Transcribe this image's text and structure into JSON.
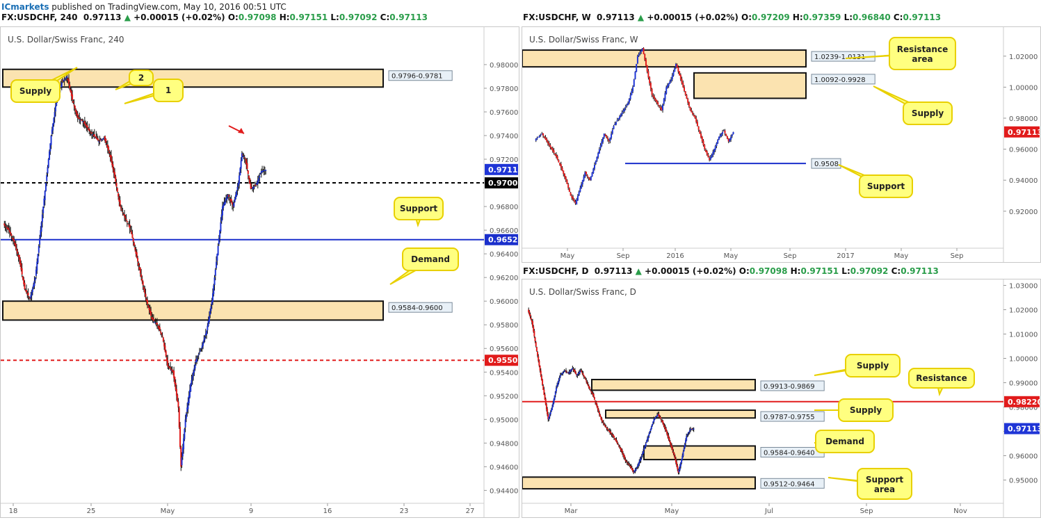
{
  "topbar": {
    "brand": "ICmarkets",
    "text": " published on TradingView.com, May 10, 2016 00:51 UTC"
  },
  "panels": [
    {
      "header": {
        "symbol": "FX:USDCHF, 240",
        "last": "0.97113",
        "change": "+0.00015 (+0.02%)",
        "o": "0.97098",
        "h": "0.97151",
        "l": "0.97092",
        "c": "0.97113"
      },
      "title": "U.S. Dollar/Swiss Franc, 240"
    },
    {
      "header": {
        "symbol": "FX:USDCHF, W",
        "last": "0.97113",
        "change": "+0.00015 (+0.02%)",
        "o": "0.97209",
        "h": "0.97359",
        "l": "0.96840",
        "c": "0.97113"
      },
      "title": "U.S. Dollar/Swiss Franc, W"
    },
    {
      "header": {
        "symbol": "FX:USDCHF, D",
        "last": "0.97113",
        "change": "+0.00015 (+0.02%)",
        "o": "0.97098",
        "h": "0.97151",
        "l": "0.97092",
        "c": "0.97113"
      },
      "title": "U.S. Dollar/Swiss Franc, D"
    }
  ],
  "chart_data": [
    {
      "type": "candlestick",
      "title": "U.S. Dollar/Swiss Franc, 240",
      "ylim": [
        0.9432,
        0.9817
      ],
      "y_ticks": [
        "0.98000",
        "0.97800",
        "0.97600",
        "0.97400",
        "0.97200",
        "0.97000",
        "0.96800",
        "0.96600",
        "0.96400",
        "0.96200",
        "0.96000",
        "0.95800",
        "0.95600",
        "0.95400",
        "0.95200",
        "0.95000",
        "0.94800",
        "0.94600",
        "0.94400"
      ],
      "x_ticks": [
        "18",
        "25",
        "May",
        "9",
        "16",
        "23",
        "27"
      ],
      "last_price_label": "0.97113",
      "zones": [
        {
          "label": "0.9796-0.9781",
          "high": 0.9796,
          "low": 0.9781
        },
        {
          "label": "0.9584-0.9600",
          "high": 0.96,
          "low": 0.9584
        }
      ],
      "levels": [
        {
          "label": "0.97000",
          "value": 0.97,
          "style": "dashed",
          "color": "#000000"
        },
        {
          "label": "0.96520",
          "value": 0.9652,
          "style": "solid",
          "color": "#1a2fcc"
        },
        {
          "label": "0.95500",
          "value": 0.955,
          "style": "dashed",
          "color": "#e11b1b"
        }
      ],
      "annotations": [
        "Supply",
        "2",
        "1",
        "Support",
        "Demand"
      ],
      "close_path": [
        [
          0,
          0.9665
        ],
        [
          6,
          0.966
        ],
        [
          12,
          0.965
        ],
        [
          18,
          0.9635
        ],
        [
          24,
          0.961
        ],
        [
          30,
          0.9602
        ],
        [
          36,
          0.962
        ],
        [
          42,
          0.966
        ],
        [
          48,
          0.97
        ],
        [
          54,
          0.974
        ],
        [
          60,
          0.977
        ],
        [
          66,
          0.9785
        ],
        [
          72,
          0.979
        ],
        [
          78,
          0.977
        ],
        [
          84,
          0.9755
        ],
        [
          90,
          0.9752
        ],
        [
          96,
          0.9745
        ],
        [
          102,
          0.974
        ],
        [
          108,
          0.9735
        ],
        [
          114,
          0.9738
        ],
        [
          120,
          0.9725
        ],
        [
          126,
          0.9705
        ],
        [
          132,
          0.968
        ],
        [
          138,
          0.967
        ],
        [
          144,
          0.966
        ],
        [
          150,
          0.964
        ],
        [
          156,
          0.962
        ],
        [
          162,
          0.96
        ],
        [
          168,
          0.9585
        ],
        [
          174,
          0.958
        ],
        [
          180,
          0.957
        ],
        [
          186,
          0.9545
        ],
        [
          192,
          0.954
        ],
        [
          198,
          0.951
        ],
        [
          201,
          0.946
        ],
        [
          206,
          0.95
        ],
        [
          212,
          0.953
        ],
        [
          218,
          0.955
        ],
        [
          224,
          0.956
        ],
        [
          230,
          0.9575
        ],
        [
          236,
          0.96
        ],
        [
          242,
          0.964
        ],
        [
          248,
          0.968
        ],
        [
          254,
          0.969
        ],
        [
          260,
          0.968
        ],
        [
          266,
          0.97
        ],
        [
          270,
          0.9725
        ],
        [
          274,
          0.972
        ],
        [
          280,
          0.9695
        ],
        [
          286,
          0.9698
        ],
        [
          292,
          0.971
        ],
        [
          297,
          0.9711
        ]
      ]
    },
    {
      "type": "candlestick",
      "title": "U.S. Dollar/Swiss Franc, W",
      "ylim": [
        0.8975,
        1.032
      ],
      "y_ticks": [
        "1.02000",
        "1.00000",
        "0.98000",
        "0.96000",
        "0.94000",
        "0.92000"
      ],
      "x_ticks": [
        "May",
        "Sep",
        "2016",
        "May",
        "Sep",
        "2017",
        "May",
        "Sep"
      ],
      "last_price_label": "0.97113",
      "zones": [
        {
          "label": "1.0239-1.0131",
          "high": 1.0239,
          "low": 1.0131
        },
        {
          "label": "1.0092-0.9928",
          "high": 1.0092,
          "low": 0.9928
        }
      ],
      "levels": [
        {
          "label": "0.9508",
          "value": 0.9508,
          "style": "solid",
          "color": "#1a2fcc"
        }
      ],
      "annotations": [
        "Resistance area",
        "Supply",
        "Support"
      ],
      "close_path": [
        [
          0,
          0.966
        ],
        [
          6,
          0.97
        ],
        [
          10,
          0.965
        ],
        [
          14,
          0.96
        ],
        [
          18,
          0.955
        ],
        [
          22,
          0.948
        ],
        [
          26,
          0.94
        ],
        [
          30,
          0.93
        ],
        [
          34,
          0.925
        ],
        [
          38,
          0.935
        ],
        [
          42,
          0.945
        ],
        [
          46,
          0.94
        ],
        [
          50,
          0.95
        ],
        [
          54,
          0.96
        ],
        [
          58,
          0.97
        ],
        [
          62,
          0.965
        ],
        [
          66,
          0.975
        ],
        [
          70,
          0.98
        ],
        [
          74,
          0.985
        ],
        [
          78,
          0.99
        ],
        [
          82,
          1.0
        ],
        [
          86,
          1.02
        ],
        [
          90,
          1.025
        ],
        [
          94,
          1.01
        ],
        [
          98,
          0.995
        ],
        [
          102,
          0.99
        ],
        [
          106,
          0.985
        ],
        [
          110,
          1.0
        ],
        [
          114,
          1.005
        ],
        [
          118,
          1.015
        ],
        [
          122,
          1.005
        ],
        [
          126,
          0.995
        ],
        [
          130,
          0.985
        ],
        [
          134,
          0.98
        ],
        [
          138,
          0.97
        ],
        [
          142,
          0.96
        ],
        [
          146,
          0.953
        ],
        [
          150,
          0.96
        ],
        [
          154,
          0.968
        ],
        [
          158,
          0.972
        ],
        [
          162,
          0.965
        ],
        [
          166,
          0.9711
        ]
      ]
    },
    {
      "type": "candlestick",
      "title": "U.S. Dollar/Swiss Franc, D",
      "ylim": [
        0.941,
        1.031
      ],
      "y_ticks": [
        "1.03000",
        "1.02000",
        "1.01000",
        "1.00000",
        "0.99000",
        "0.98000",
        "0.97000",
        "0.96000",
        "0.95000",
        "0.94000"
      ],
      "x_ticks": [
        "Mar",
        "May",
        "Jul",
        "Sep",
        "Nov"
      ],
      "last_price_label": "0.97113",
      "zones": [
        {
          "label": "0.9913-0.9869",
          "high": 0.9913,
          "low": 0.9869
        },
        {
          "label": "0.9787-0.9755",
          "high": 0.9787,
          "low": 0.9755
        },
        {
          "label": "0.9584-0.9640",
          "high": 0.964,
          "low": 0.9584
        },
        {
          "label": "0.9512-0.9464",
          "high": 0.9512,
          "low": 0.9464
        }
      ],
      "levels": [
        {
          "label": "0.98220",
          "value": 0.9822,
          "style": "solid",
          "color": "#e11b1b"
        }
      ],
      "annotations": [
        "Supply",
        "Resistance",
        "Supply",
        "Demand",
        "Support area"
      ],
      "close_path": [
        [
          0,
          1.02
        ],
        [
          5,
          1.015
        ],
        [
          10,
          1.005
        ],
        [
          15,
          0.995
        ],
        [
          20,
          0.985
        ],
        [
          25,
          0.975
        ],
        [
          30,
          0.98
        ],
        [
          35,
          0.988
        ],
        [
          40,
          0.993
        ],
        [
          45,
          0.995
        ],
        [
          50,
          0.994
        ],
        [
          55,
          0.996
        ],
        [
          60,
          0.993
        ],
        [
          65,
          0.995
        ],
        [
          70,
          0.992
        ],
        [
          75,
          0.988
        ],
        [
          80,
          0.985
        ],
        [
          85,
          0.98
        ],
        [
          90,
          0.975
        ],
        [
          95,
          0.972
        ],
        [
          100,
          0.97
        ],
        [
          105,
          0.968
        ],
        [
          110,
          0.965
        ],
        [
          115,
          0.962
        ],
        [
          120,
          0.958
        ],
        [
          125,
          0.956
        ],
        [
          130,
          0.953
        ],
        [
          135,
          0.956
        ],
        [
          140,
          0.96
        ],
        [
          145,
          0.965
        ],
        [
          150,
          0.97
        ],
        [
          155,
          0.975
        ],
        [
          160,
          0.977
        ],
        [
          165,
          0.974
        ],
        [
          170,
          0.97
        ],
        [
          175,
          0.965
        ],
        [
          180,
          0.96
        ],
        [
          185,
          0.953
        ],
        [
          190,
          0.96
        ],
        [
          195,
          0.968
        ],
        [
          200,
          0.971
        ],
        [
          204,
          0.9711
        ]
      ]
    }
  ]
}
